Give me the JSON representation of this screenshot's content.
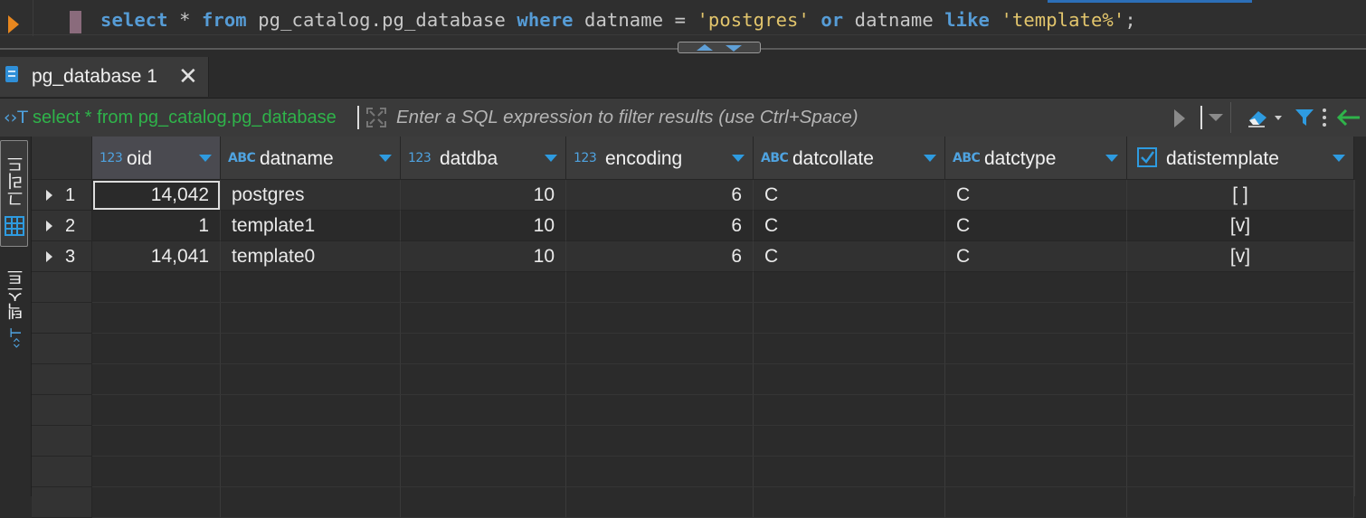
{
  "editor": {
    "sql": [
      {
        "t": "select",
        "k": "kw"
      },
      {
        "t": " * ",
        "k": ""
      },
      {
        "t": "from",
        "k": "kw"
      },
      {
        "t": " pg_catalog.pg_database ",
        "k": ""
      },
      {
        "t": "where",
        "k": "kw"
      },
      {
        "t": " datname = ",
        "k": ""
      },
      {
        "t": "'postgres'",
        "k": "str"
      },
      {
        "t": " ",
        "k": ""
      },
      {
        "t": "or",
        "k": "kw"
      },
      {
        "t": " datname ",
        "k": ""
      },
      {
        "t": "like",
        "k": "kw"
      },
      {
        "t": " ",
        "k": ""
      },
      {
        "t": "'template%'",
        "k": "str"
      },
      {
        "t": ";",
        "k": ""
      }
    ]
  },
  "results_tab": {
    "label": "pg_database 1",
    "close_glyph": "✕"
  },
  "filter": {
    "query_text": "select * from pg_catalog.pg_database",
    "placeholder": "Enter a SQL expression to filter results (use Ctrl+Space)",
    "t_icon_glyph": "‹›T"
  },
  "side_tabs": {
    "grid_label": "그리드",
    "text_label": "텍스트"
  },
  "grid": {
    "columns": [
      {
        "name": "oid",
        "type_icon": "123",
        "kind": "num"
      },
      {
        "name": "datname",
        "type_icon": "ABC",
        "kind": "text"
      },
      {
        "name": "datdba",
        "type_icon": "123",
        "kind": "num"
      },
      {
        "name": "encoding",
        "type_icon": "123",
        "kind": "num"
      },
      {
        "name": "datcollate",
        "type_icon": "ABC",
        "kind": "text"
      },
      {
        "name": "datctype",
        "type_icon": "ABC",
        "kind": "text"
      },
      {
        "name": "datistemplate",
        "type_icon": "check",
        "kind": "bool"
      }
    ],
    "rows": [
      {
        "num": "1",
        "cells": [
          "14,042",
          "postgres",
          "10",
          "6",
          "C",
          "C",
          "[ ]"
        ]
      },
      {
        "num": "2",
        "cells": [
          "1",
          "template1",
          "10",
          "6",
          "C",
          "C",
          "[v]"
        ]
      },
      {
        "num": "3",
        "cells": [
          "14,041",
          "template0",
          "10",
          "6",
          "C",
          "C",
          "[v]"
        ]
      }
    ]
  },
  "colors": {
    "keyword": "#569cd6",
    "string": "#e2c56c",
    "accent": "#2e9be0",
    "filter_query": "#2fb34a",
    "run_marker": "#e8871e"
  }
}
